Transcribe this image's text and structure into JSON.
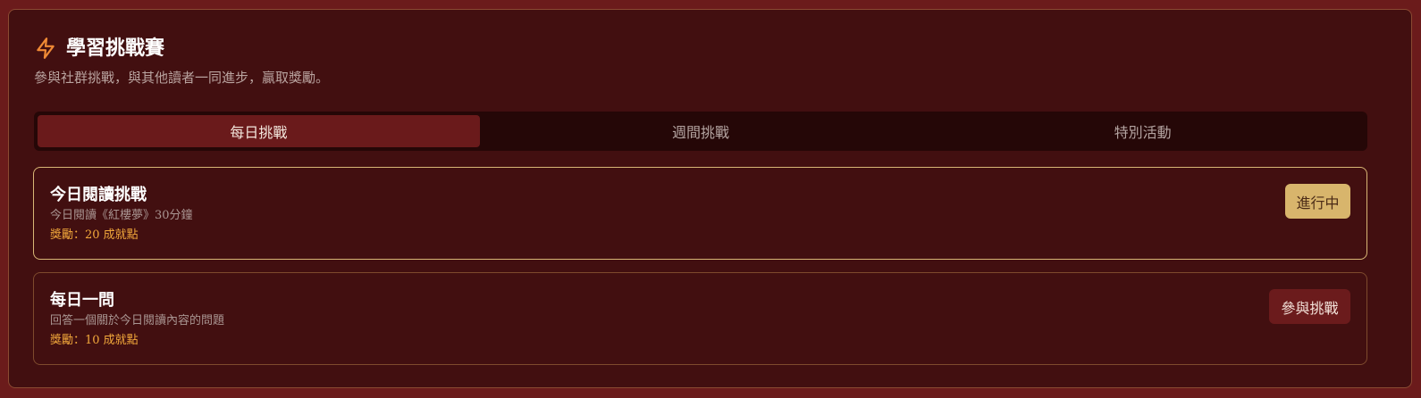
{
  "header": {
    "icon": "lightning-bolt-icon",
    "title": "學習挑戰賽",
    "subtitle": "參與社群挑戰，與其他讀者一同進步，贏取獎勵。"
  },
  "tabs": [
    {
      "label": "每日挑戰",
      "active": true
    },
    {
      "label": "週間挑戰",
      "active": false
    },
    {
      "label": "特別活動",
      "active": false
    }
  ],
  "challenges": [
    {
      "title": "今日閱讀挑戰",
      "description": "今日閱讀《紅樓夢》30分鐘",
      "reward": "獎勵：20 成就點",
      "button": "進行中"
    },
    {
      "title": "每日一問",
      "description": "回答一個關於今日閱讀內容的問題",
      "reward": "獎勵：10 成就點",
      "button": "參與挑戰"
    }
  ],
  "colors": {
    "page_background": "#6b1b1b",
    "panel_background": "#420f10",
    "accent_orange": "#f2a83b",
    "active_tab": "#6a1a1b",
    "progress_button": "#d8b56c"
  }
}
